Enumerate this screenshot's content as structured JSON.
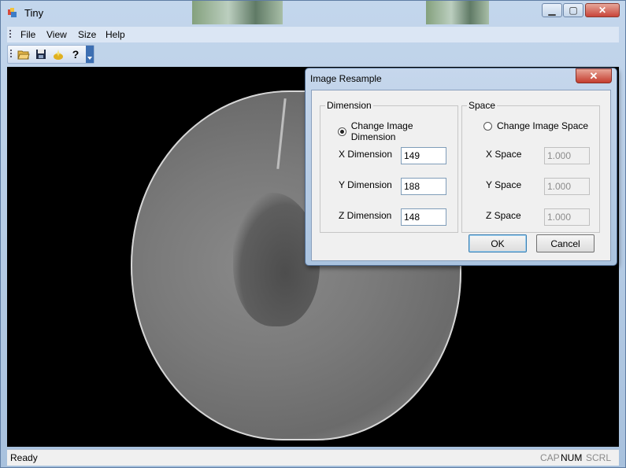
{
  "window": {
    "title": "Tiny"
  },
  "menu": [
    "File",
    "View",
    "Size",
    "Help"
  ],
  "toolbar": {
    "icons": [
      "open-folder-icon",
      "save-icon",
      "wizard-icon",
      "help-icon"
    ]
  },
  "status": {
    "text": "Ready",
    "cap": "CAP",
    "num": "NUM",
    "scrl": "SCRL"
  },
  "dialog": {
    "title": "Image Resample",
    "dimension": {
      "caption": "Dimension",
      "radio_label": "Change Image Dimension",
      "x_label": "X Dimension",
      "x_value": "149",
      "y_label": "Y Dimension",
      "y_value": "188",
      "z_label": "Z Dimension",
      "z_value": "148"
    },
    "space": {
      "caption": "Space",
      "radio_label": "Change Image Space",
      "x_label": "X Space",
      "x_value": "1.000",
      "y_label": "Y Space",
      "y_value": "1.000",
      "z_label": "Z Space",
      "z_value": "1.000"
    },
    "ok": "OK",
    "cancel": "Cancel"
  }
}
